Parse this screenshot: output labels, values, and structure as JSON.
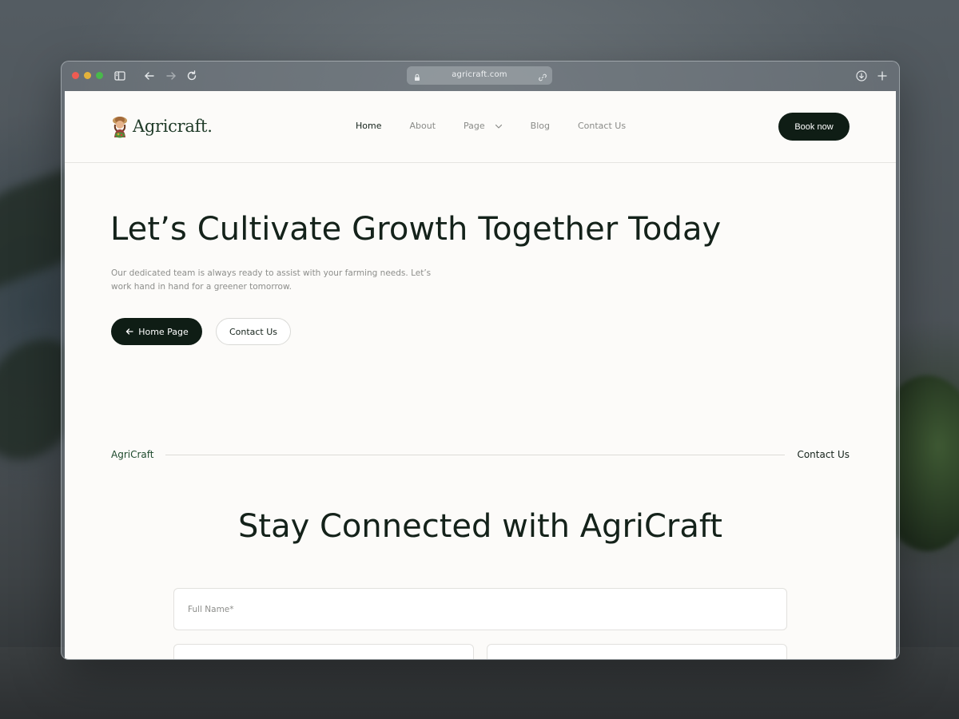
{
  "browser": {
    "url": "agricraft.com"
  },
  "nav": {
    "logo_text": "Agricraft.",
    "items": [
      {
        "label": "Home",
        "active": true
      },
      {
        "label": "About"
      },
      {
        "label": "Page",
        "has_dropdown": true
      },
      {
        "label": "Blog"
      },
      {
        "label": "Contact Us"
      }
    ],
    "cta_label": "Book now"
  },
  "hero": {
    "title": "Let’s Cultivate Growth Together Today",
    "subtitle": "Our dedicated team is always ready to assist with your farming needs. Let’s work hand in hand for a greener tomorrow.",
    "primary_button": "Home Page",
    "secondary_button": "Contact Us"
  },
  "divider": {
    "left": "AgriCraft",
    "right": "Contact Us"
  },
  "form_section": {
    "title": "Stay Connected with AgriCraft",
    "full_name_placeholder": "Full Name*"
  },
  "colors": {
    "brand_dark": "#0f1d15",
    "brand_green": "#1e4a2d",
    "page_bg": "#fcfbf9"
  }
}
